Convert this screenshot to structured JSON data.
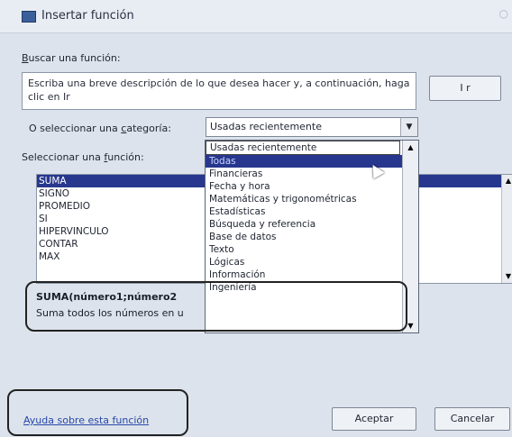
{
  "window": {
    "title": "Insertar función",
    "close": "○"
  },
  "search": {
    "label_prefix": "B",
    "label_rest": "uscar una función:",
    "text": "Escriba una breve descripción de lo que desea hacer y, a continuación, haga clic en Ir",
    "go_label": "I r"
  },
  "category": {
    "label_prefix": "O seleccionar una ",
    "label_key": "c",
    "label_rest": "ategoría:",
    "selected": "Usadas recientemente",
    "options": [
      "Usadas recientemente",
      "Todas",
      "Financieras",
      "Fecha y hora",
      "Matemáticas y trigonométricas",
      "Estadísticas",
      "Búsqueda y referencia",
      "Base de datos",
      "Texto",
      "Lógicas",
      "Información",
      "Ingeniería"
    ],
    "highlighted_index": 1
  },
  "functions": {
    "label_prefix": "Seleccionar una ",
    "label_key": "f",
    "label_rest": "unción:",
    "items": [
      "SUMA",
      "SIGNO",
      "PROMEDIO",
      "SI",
      "HIPERVINCULO",
      "CONTAR",
      "MAX"
    ],
    "selected_index": 0
  },
  "signature": "SUMA(número1;número2",
  "description": "Suma todos los números en u",
  "help_link": "Ayuda sobre esta función",
  "buttons": {
    "ok": "Aceptar",
    "cancel": "Cancelar"
  }
}
